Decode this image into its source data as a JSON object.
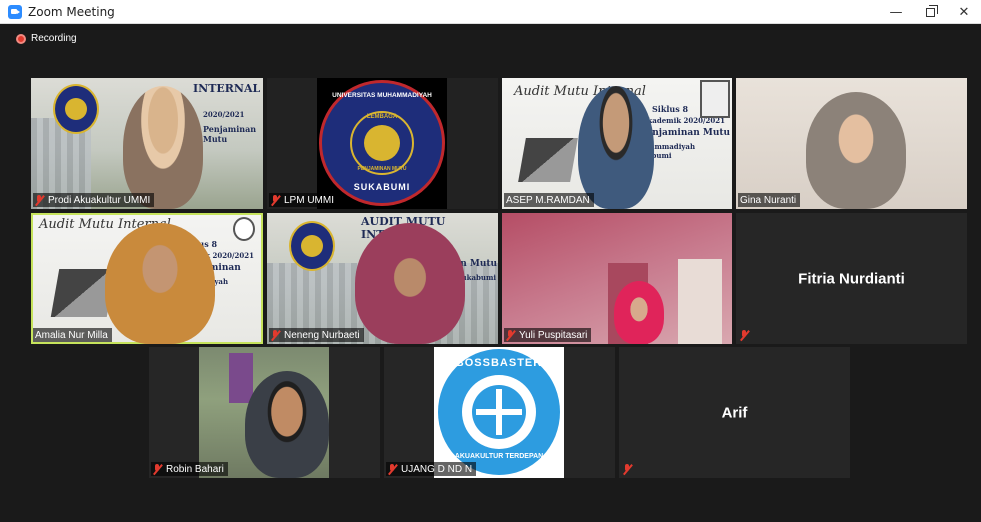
{
  "window": {
    "title": "Zoom Meeting",
    "controls": {
      "minimize": "—",
      "close": "✕"
    }
  },
  "recording": {
    "label": "Recording"
  },
  "participants": [
    {
      "name": "Prodi Akuakultur UMMI",
      "muted": true
    },
    {
      "name": "LPM UMMI",
      "muted": true
    },
    {
      "name": "ASEP M.RAMDAN",
      "muted": false
    },
    {
      "name": "Gina Nuranti",
      "muted": false
    },
    {
      "name": "Amalia Nur Milla",
      "muted": false,
      "speaking": true
    },
    {
      "name": "Neneng Nurbaeti",
      "muted": true
    },
    {
      "name": "Yuli Puspitasari",
      "muted": true
    },
    {
      "name": "Fitria Nurdianti",
      "muted": true,
      "video": false
    },
    {
      "name": "Robin Bahari",
      "muted": true
    },
    {
      "name": "UJANG D ND N",
      "muted": true
    },
    {
      "name": "Arif",
      "muted": true,
      "video": false
    }
  ],
  "slides": {
    "audit_title": "AUDIT MUTU INTERNAL",
    "audit_title_partial": "INTERNAL",
    "script_title": "Audit Mutu Internal",
    "siklus": "Siklus 8",
    "year": "Akademik 2020/2021",
    "year_short": "2020/2021",
    "penjaminan": "Penjaminan Mutu",
    "univ": "Muhammadiyah Sukabumi",
    "lembaga": "Lembaga"
  },
  "logos": {
    "ummi": {
      "top": "UNIVERSITAS MUHAMMADIYAH",
      "middle": "LEMBAGA",
      "inner": "PENJAMINAN MUTU",
      "bottom": "SUKABUMI"
    },
    "bossbaster": {
      "top": "BOSSBASTER",
      "bottom": "AKUAKULTUR TERDEPAN"
    }
  },
  "colors": {
    "accent_speaking": "#c6e35c",
    "muted_red": "#e23a2e",
    "ummi_blue": "#1e2d7a",
    "ummi_red": "#c0282d",
    "ummi_gold": "#d9b530",
    "bossbaster_blue": "#2d9ce0"
  }
}
